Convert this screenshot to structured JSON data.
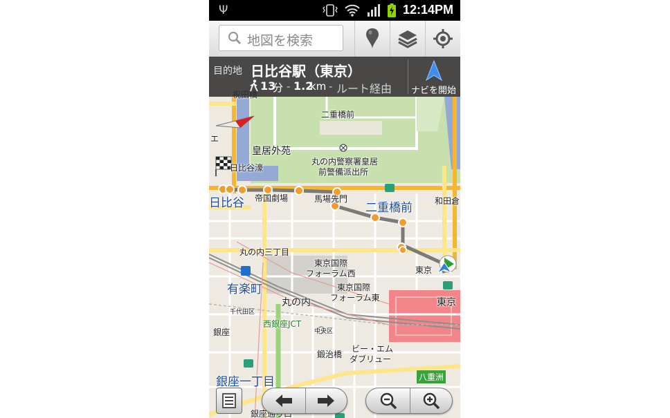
{
  "status_bar": {
    "time": "12:14PM",
    "icons": [
      "usb-icon",
      "vibrate-icon",
      "wifi-icon",
      "signal-icon",
      "battery-charging-icon"
    ]
  },
  "search": {
    "placeholder": "地図を検索",
    "icons": [
      "search-icon",
      "place-pin-icon",
      "layers-icon",
      "my-location-icon"
    ]
  },
  "route": {
    "dest_label": "目的地",
    "dest_name": "日比谷駅（東京）",
    "duration_value": "13",
    "duration_unit": "分",
    "separator": "-",
    "distance_value": "1.2",
    "distance_unit": "km",
    "via": "ルート経由",
    "navi_label": "ナビを開始"
  },
  "map_labels": {
    "shirotakabashi": "祝田橋",
    "nijubashimae_top": "二重橋前",
    "kokyo_gaien": "皇居外苑",
    "marunouchi_police": "丸の内警察署皇居",
    "police_box": "前警備派出所",
    "hibiya_bori": "日比谷濠",
    "hibiya": "日比谷",
    "teikoku_gekijo": "帝国劇場",
    "babasakimon": "馬場先門",
    "nijubashimae": "二重橋前",
    "wadakura": "和田倉",
    "marunouchi_3": "丸の内三丁目",
    "tokyo_forum_west_1": "東京国際",
    "tokyo_forum_west_2": "フォーラム西",
    "tokyo_forum_east_1": "東京国際",
    "tokyo_forum_east_2": "フォーラム東",
    "tokyo_small": "東京",
    "tokyo_station": "東京",
    "yurakucho": "有楽町",
    "marunouchi": "丸の内",
    "chiyoda": "千代田区",
    "nishiginza_jct": "西銀座JCT",
    "chuo_ku": "中央区",
    "ginza": "銀座",
    "kajibashi": "鍛治橋",
    "bmw_1": "ビー・エム",
    "bmw_2": "ダブリュー",
    "yaesu": "八重洲",
    "ginza_1": "銀座一丁目",
    "ginza_dori": "銀座通り口",
    "e_label": "エ"
  },
  "colors": {
    "expressway": "#fde689",
    "road_major": "#f5b731",
    "moat": "#95a9d7",
    "park": "#c8e2b0",
    "route_line": "#6f6f6f",
    "station_green": "#3aa13c"
  }
}
